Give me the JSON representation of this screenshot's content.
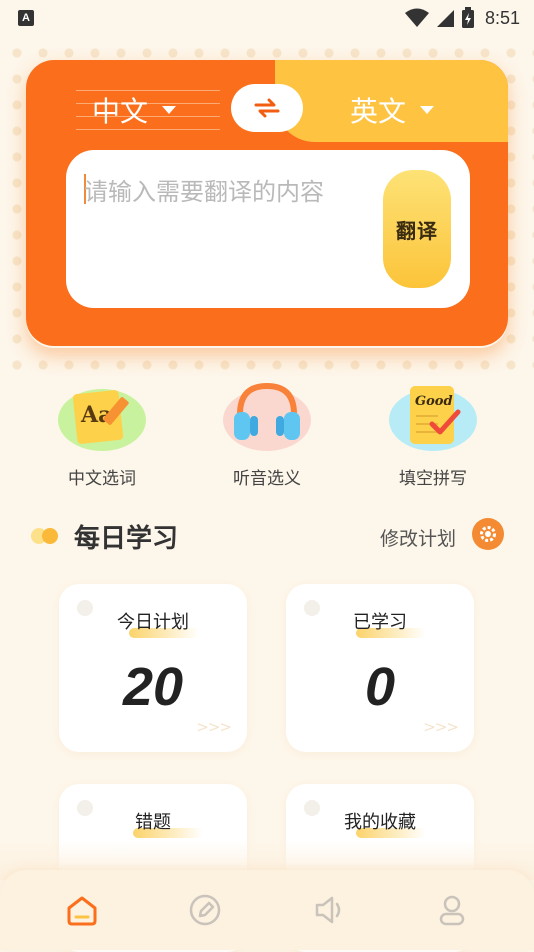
{
  "status_bar": {
    "app_icon": "A",
    "time": "8:51",
    "icons": [
      "wifi-icon",
      "signal-icon",
      "battery-icon"
    ]
  },
  "translator": {
    "source_language": "中文",
    "target_language": "英文",
    "input_placeholder": "请输入需要翻译的内容",
    "input_value": "",
    "translate_label": "翻译"
  },
  "features": [
    {
      "label": "中文选词",
      "icon": "chinese-word-icon"
    },
    {
      "label": "听音选义",
      "icon": "headphones-icon"
    },
    {
      "label": "填空拼写",
      "icon": "spelling-notebook-icon"
    }
  ],
  "daily": {
    "title": "每日学习",
    "modify_label": "修改计划",
    "cards": [
      {
        "title": "今日计划",
        "value": "20"
      },
      {
        "title": "已学习",
        "value": "0"
      },
      {
        "title": "错题",
        "value": ""
      },
      {
        "title": "我的收藏",
        "value": ""
      }
    ]
  },
  "bottom_nav": [
    {
      "name": "home",
      "icon": "home-icon",
      "active": true
    },
    {
      "name": "edit",
      "icon": "pencil-icon",
      "active": false
    },
    {
      "name": "audio",
      "icon": "speaker-icon",
      "active": false
    },
    {
      "name": "profile",
      "icon": "user-icon",
      "active": false
    }
  ],
  "colors": {
    "accent_orange": "#fb6f1c",
    "accent_yellow": "#fdc341",
    "background": "#fdf6ea"
  }
}
